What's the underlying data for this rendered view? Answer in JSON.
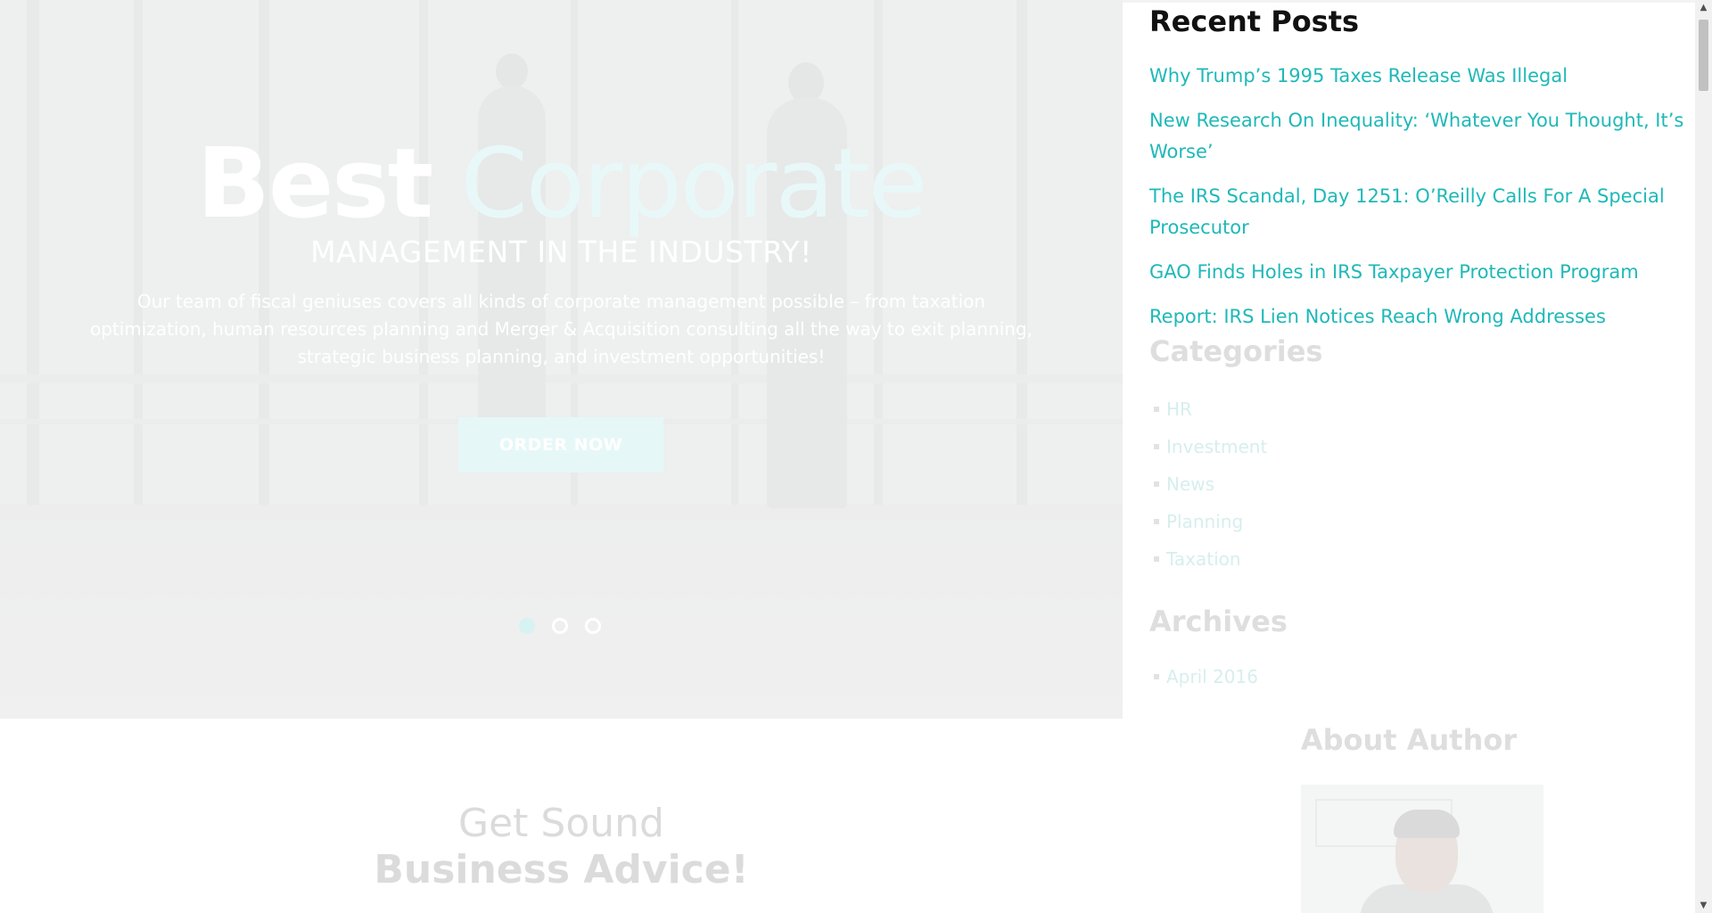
{
  "hero": {
    "title_bold": "Best",
    "title_light": "Corporate",
    "subtitle": "MANAGEMENT IN THE INDUSTRY!",
    "description": "Our team of fiscal geniuses covers all kinds of corporate management possible – from taxation optimization, human resources planning and Merger & Acquisition consulting all the way to exit planning, strategic business planning, and investment opportunities!",
    "button_label": "ORDER NOW",
    "slides": 3,
    "active_slide": 1
  },
  "advice": {
    "line1": "Get Sound",
    "line2": "Business Advice!"
  },
  "sidebar": {
    "recent_posts": {
      "heading": "Recent Posts",
      "items": [
        "Why Trump’s 1995 Taxes Release Was Illegal",
        "New Research On Inequality: ‘Whatever You Thought, It’s Worse’",
        "The IRS Scandal, Day 1251: O’Reilly Calls For A Special Prosecutor",
        "GAO Finds Holes in IRS Taxpayer Protection Program",
        "Report: IRS Lien Notices Reach Wrong Addresses"
      ]
    },
    "categories": {
      "heading": "Categories",
      "items": [
        "HR",
        "Investment",
        "News",
        "Planning",
        "Taxation"
      ]
    },
    "archives": {
      "heading": "Archives",
      "items": [
        "April 2016"
      ]
    },
    "about_author": {
      "heading": "About Author"
    }
  },
  "colors": {
    "accent": "#1fb8b8",
    "heading": "#111111",
    "faded": "#dedede"
  }
}
